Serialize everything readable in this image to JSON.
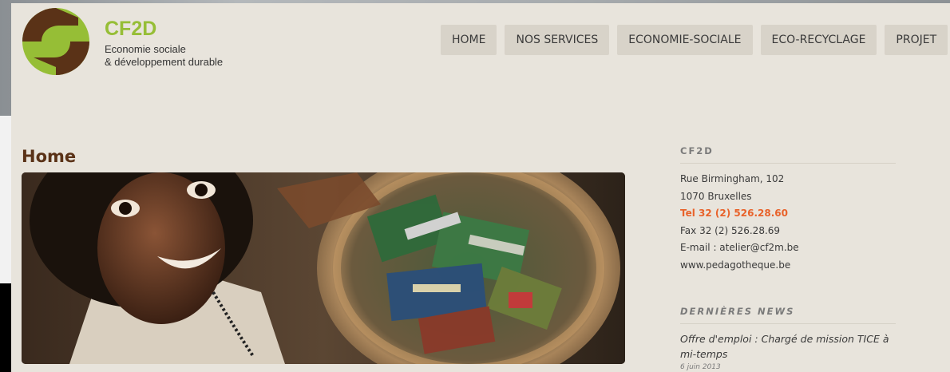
{
  "brand": {
    "name": "CF2D",
    "tagline_line1": "Economie sociale",
    "tagline_line2": "& développement durable",
    "colors": {
      "green": "#96be36",
      "brown": "#5a3217",
      "accent": "#e8622a"
    }
  },
  "nav": {
    "items": [
      {
        "label": "HOME"
      },
      {
        "label": "NOS SERVICES"
      },
      {
        "label": "ECONOMIE-SOCIALE"
      },
      {
        "label": "ECO-RECYCLAGE"
      },
      {
        "label": "PROJET"
      }
    ]
  },
  "main": {
    "title": "Home",
    "hero_icon": "photo-girl-with-basket-of-circuit-boards"
  },
  "sidebar": {
    "contact": {
      "heading": "CF2D",
      "address": "Rue Birmingham, 102",
      "city": "1070 Bruxelles",
      "tel": "Tel 32 (2) 526.28.60",
      "fax": "Fax 32 (2) 526.28.69",
      "email": "E-mail : atelier@cf2m.be",
      "website": "www.pedagotheque.be"
    },
    "news": {
      "heading": "DERNIÈRES NEWS",
      "items": [
        {
          "title": "Offre d'emploi : Chargé de mission TICE à mi-temps",
          "date": "6 juin 2013"
        }
      ]
    }
  }
}
